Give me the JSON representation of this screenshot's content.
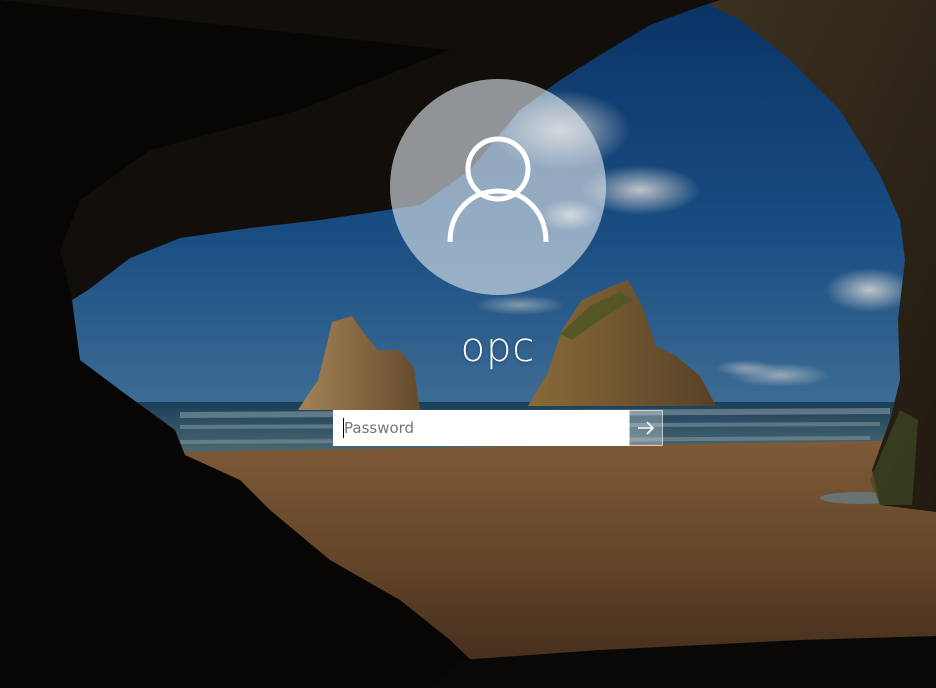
{
  "user": {
    "name": "opc"
  },
  "password": {
    "placeholder": "Password",
    "value": ""
  },
  "icons": {
    "avatar": "user-silhouette-icon",
    "submit": "arrow-right-icon"
  },
  "colors": {
    "avatar_circle": "#e1e6ec",
    "text": "#ffffff",
    "input_bg": "#ffffff",
    "placeholder": "#767676"
  }
}
